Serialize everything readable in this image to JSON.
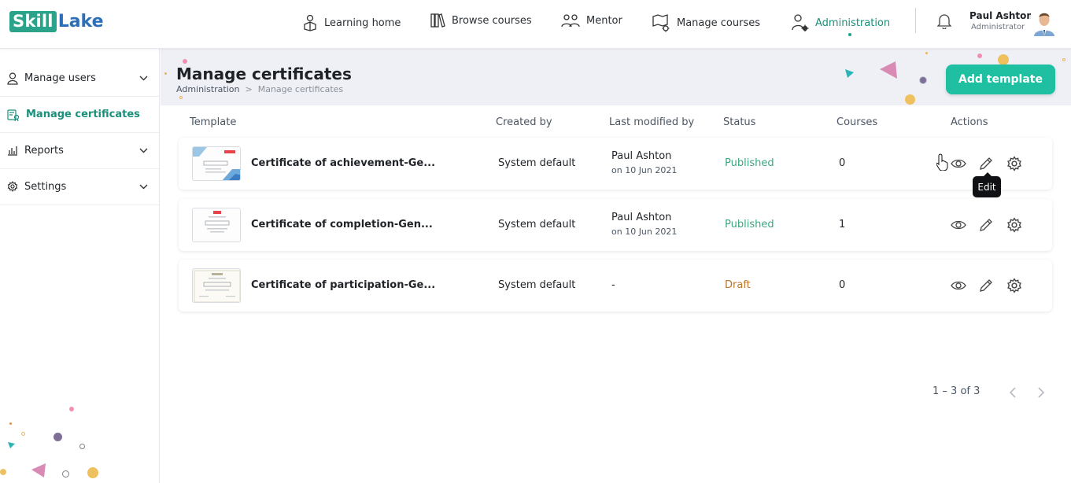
{
  "brand": {
    "logo_part1": "Skill",
    "logo_part2": "Lake"
  },
  "topnav": {
    "items": [
      {
        "label": "Learning home",
        "icon": "learning-home-icon"
      },
      {
        "label": "Browse courses",
        "icon": "books-icon"
      },
      {
        "label": "Mentor",
        "icon": "mentor-icon"
      },
      {
        "label": "Manage courses",
        "icon": "manage-courses-icon"
      },
      {
        "label": "Administration",
        "icon": "admin-user-gear-icon",
        "active": true
      }
    ],
    "notifications_icon": "bell-icon"
  },
  "user": {
    "name": "Paul Ashton",
    "role": "Administrator"
  },
  "sidebar": {
    "items": [
      {
        "label": "Manage users",
        "icon": "user-icon",
        "expandable": true
      },
      {
        "label": "Manage certificates",
        "icon": "certificate-icon",
        "active": true
      },
      {
        "label": "Reports",
        "icon": "chart-icon",
        "expandable": true
      },
      {
        "label": "Settings",
        "icon": "gear-icon",
        "expandable": true
      }
    ]
  },
  "page": {
    "title": "Manage certificates",
    "breadcrumb": {
      "parent": "Administration",
      "separator": ">",
      "current": "Manage certificates"
    },
    "add_button": "Add template"
  },
  "table": {
    "columns": [
      "Template",
      "Created by",
      "Last modified by",
      "Status",
      "Courses",
      "Actions"
    ],
    "rows": [
      {
        "name": "Certificate of achievement-Ge...",
        "created_by": "System default",
        "modified_by": "Paul Ashton",
        "modified_on": "on 10 Jun 2021",
        "status": "Published",
        "courses": "0"
      },
      {
        "name": "Certificate of completion-Gen...",
        "created_by": "System default",
        "modified_by": "Paul Ashton",
        "modified_on": "on 10 Jun 2021",
        "status": "Published",
        "courses": "1"
      },
      {
        "name": "Certificate of participation-Ge...",
        "created_by": "System default",
        "modified_by": "-",
        "modified_on": "",
        "status": "Draft",
        "courses": "0"
      }
    ],
    "actions": [
      "view-icon",
      "edit-icon",
      "settings-icon"
    ]
  },
  "tooltip": "Edit",
  "pagination": {
    "range": "1 – 3 of 3"
  },
  "colors": {
    "accent": "#1a8f7a",
    "button": "#1fbfa2",
    "published": "#3aa77f",
    "draft": "#b8762b",
    "header_band": "#eef0f6"
  }
}
